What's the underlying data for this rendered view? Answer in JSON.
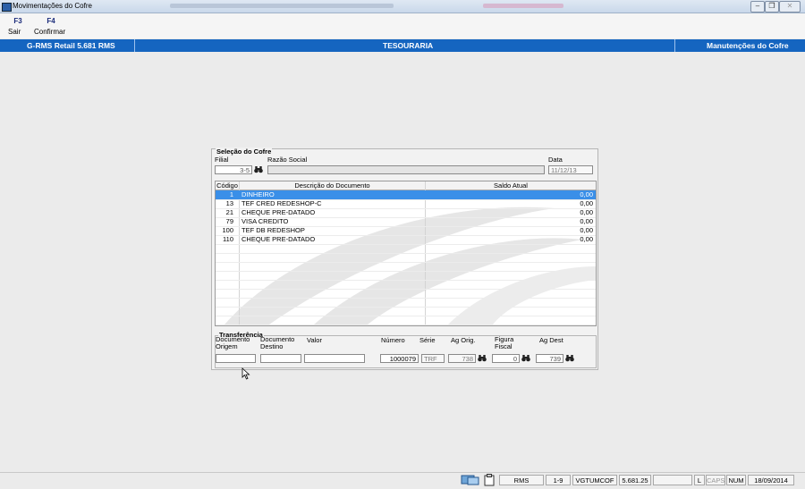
{
  "window": {
    "title": "Movimentações do Cofre"
  },
  "toolbar": {
    "sair": {
      "key": "F3",
      "label": "Sair"
    },
    "confirmar": {
      "key": "F4",
      "label": "Confirmar"
    }
  },
  "header": {
    "left": "G-RMS Retail 5.681 RMS",
    "center": "TESOURARIA",
    "right": "Manutenções do Cofre",
    "color": "#1565c0"
  },
  "selecao": {
    "group_title": "Seleção do Cofre",
    "filial_label": "Filial",
    "filial_value": "3-5",
    "razao_label": "Razão Social",
    "razao_value": "",
    "data_label": "Data",
    "data_value": "11/12/13"
  },
  "grid": {
    "columns": [
      "Código",
      "Descrição do Documento",
      "Saldo Atual"
    ],
    "rows": [
      {
        "codigo": "1",
        "descricao": "DINHEIRO",
        "saldo": "0,00"
      },
      {
        "codigo": "13",
        "descricao": "TEF CRED REDESHOP-C",
        "saldo": "0,00"
      },
      {
        "codigo": "21",
        "descricao": "CHEQUE PRE-DATADO",
        "saldo": "0,00"
      },
      {
        "codigo": "79",
        "descricao": "VISA CREDITO",
        "saldo": "0,00"
      },
      {
        "codigo": "100",
        "descricao": "TEF DB REDESHOP",
        "saldo": "0,00"
      },
      {
        "codigo": "110",
        "descricao": "CHEQUE PRE-DATADO",
        "saldo": "0,00"
      }
    ],
    "selected_color": "#3a8fe8"
  },
  "transferencia": {
    "group_title": "Transferência",
    "doc_origem_label_1": "Documento",
    "doc_origem_label_2": "Origem",
    "doc_origem_value": "",
    "doc_destino_label_1": "Documento",
    "doc_destino_label_2": "Destino",
    "doc_destino_value": "",
    "valor_label": "Valor",
    "valor_value": "",
    "numero_label": "Número",
    "numero_value": "1000079",
    "serie_label": "Série",
    "serie_value": "TRF",
    "ag_orig_label": "Ag Orig.",
    "ag_orig_value": "738",
    "figura_label_1": "Figura",
    "figura_label_2": "Fiscal",
    "figura_value": "0",
    "ag_dest_label": "Ag Dest",
    "ag_dest_value": "739"
  },
  "statusbar": {
    "rms": "RMS",
    "page": "1-9",
    "program": "VGTUMCOF",
    "version": "5.681.25",
    "l": "L",
    "caps": "CAPS",
    "num": "NUM",
    "date": "18/09/2014"
  }
}
